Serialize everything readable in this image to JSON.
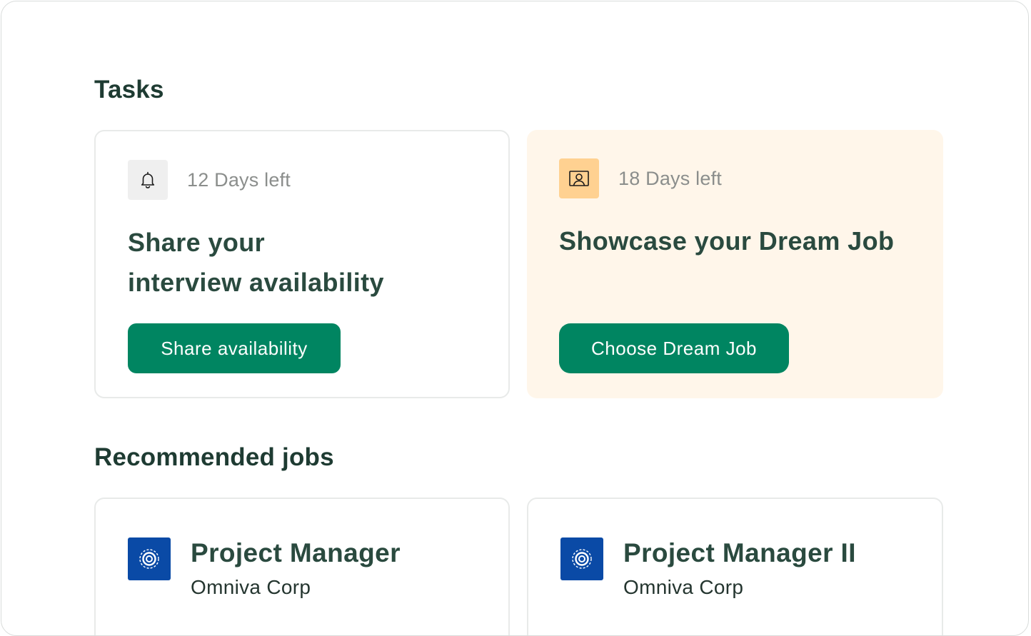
{
  "sections": {
    "tasks_title": "Tasks",
    "jobs_title": "Recommended jobs"
  },
  "tasks": [
    {
      "icon": "bell-icon",
      "days_left": "12 Days left",
      "title_line1": "Share your",
      "title_line2": "interview availability",
      "button_label": "Share availability"
    },
    {
      "icon": "portrait-icon",
      "days_left": "18 Days left",
      "title_line1": "Showcase your Dream Job",
      "button_label": "Choose Dream Job"
    }
  ],
  "jobs": [
    {
      "logo": "company-logo-icon",
      "title": "Project Manager",
      "company": "Omniva Corp"
    },
    {
      "logo": "company-logo-icon",
      "title": "Project Manager II",
      "company": "Omniva Corp"
    }
  ],
  "colors": {
    "brand_green": "#008561",
    "heading": "#1e3b32",
    "warm_card": "#fff6ea",
    "orange_icon_bg": "#ffd191",
    "logo_blue": "#0a4aa6"
  }
}
